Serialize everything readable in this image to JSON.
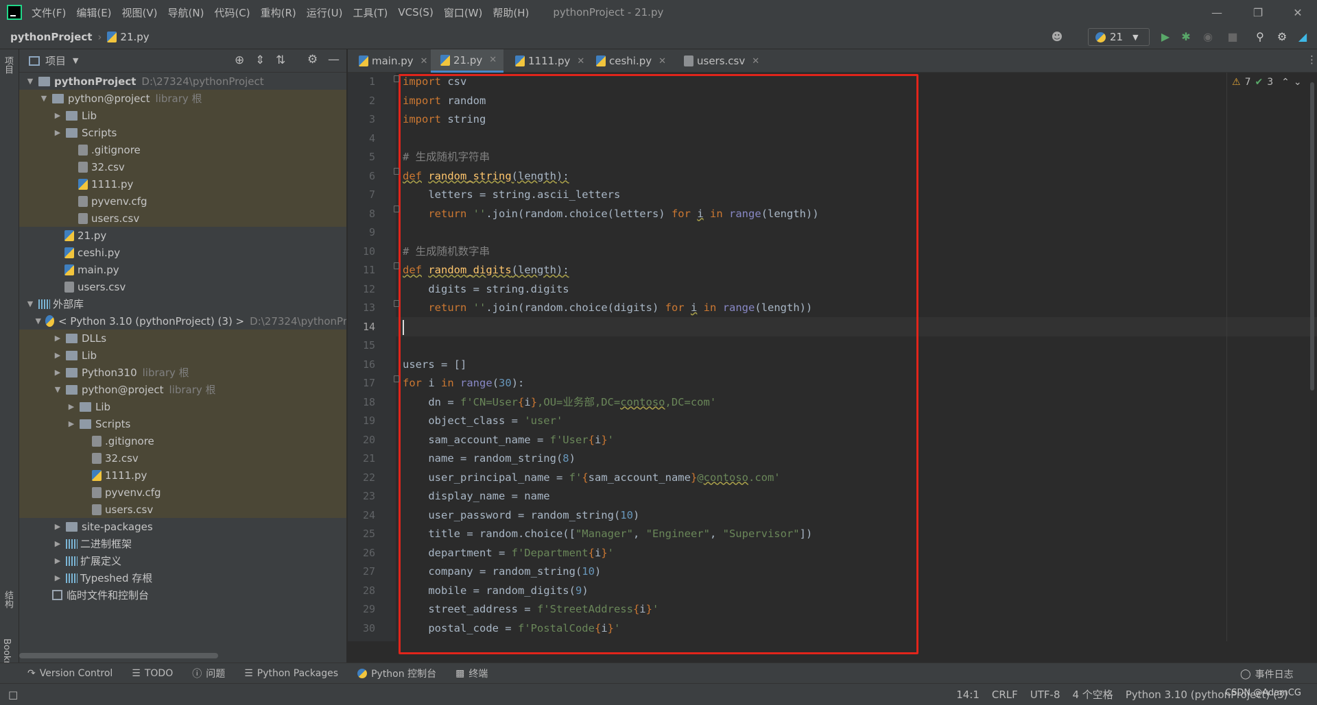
{
  "menubar": {
    "items": [
      "文件(F)",
      "编辑(E)",
      "视图(V)",
      "导航(N)",
      "代码(C)",
      "重构(R)",
      "运行(U)",
      "工具(T)",
      "VCS(S)",
      "窗口(W)",
      "帮助(H)"
    ],
    "window_title": "pythonProject - 21.py"
  },
  "navbar": {
    "project": "pythonProject",
    "file": "21.py",
    "run_config": "21"
  },
  "project_panel": {
    "title": "项目",
    "root": "pythonProject",
    "root_path": "D:\\27324\\pythonProject",
    "lib_hint": "library 根",
    "rows": [
      {
        "label": "python@project",
        "hint": "library 根"
      },
      {
        "label": "Lib"
      },
      {
        "label": "Scripts"
      },
      {
        "label": ".gitignore"
      },
      {
        "label": "32.csv"
      },
      {
        "label": "1111.py"
      },
      {
        "label": "pyvenv.cfg"
      },
      {
        "label": "users.csv"
      },
      {
        "label": "21.py"
      },
      {
        "label": "ceshi.py"
      },
      {
        "label": "main.py"
      },
      {
        "label": "users.csv"
      },
      {
        "label": "外部库"
      },
      {
        "label": "< Python 3.10 (pythonProject) (3) >",
        "hint": "D:\\27324\\pythonPr"
      },
      {
        "label": "DLLs"
      },
      {
        "label": "Lib"
      },
      {
        "label": "Python310",
        "hint": "library 根"
      },
      {
        "label": "python@project",
        "hint": "library 根"
      },
      {
        "label": "Lib"
      },
      {
        "label": "Scripts"
      },
      {
        "label": ".gitignore"
      },
      {
        "label": "32.csv"
      },
      {
        "label": "1111.py"
      },
      {
        "label": "pyvenv.cfg"
      },
      {
        "label": "users.csv"
      },
      {
        "label": "site-packages"
      },
      {
        "label": "二进制框架"
      },
      {
        "label": "扩展定义"
      },
      {
        "label": "Typeshed 存根"
      },
      {
        "label": "临时文件和控制台"
      }
    ]
  },
  "left_strip": {
    "project_tab": "项目",
    "structure_tab": "结构",
    "bookmarks_tab": "Bookmarks"
  },
  "tabs": [
    "main.py",
    "21.py",
    "1111.py",
    "ceshi.py",
    "users.csv"
  ],
  "inspections": {
    "warnings": "7",
    "ok": "3"
  },
  "editor": {
    "line_numbers": [
      "1",
      "2",
      "3",
      "4",
      "5",
      "6",
      "7",
      "8",
      "9",
      "10",
      "11",
      "12",
      "13",
      "14",
      "15",
      "16",
      "17",
      "18",
      "19",
      "20",
      "21",
      "22",
      "23",
      "24",
      "25",
      "26",
      "27",
      "28",
      "29",
      "30"
    ],
    "comment1": "# 生成随机字符串",
    "comment2": "# 生成随机数字串",
    "dn_str": "f'CN=User{i},OU=业务部,DC=contoso,DC=com'"
  },
  "bottom_tools": [
    "Version Control",
    "TODO",
    "问题",
    "Python Packages",
    "Python 控制台",
    "终端",
    "事件日志"
  ],
  "statusbar": {
    "position": "14:1",
    "line_sep": "CRLF",
    "encoding": "UTF-8",
    "indent": "4 个空格",
    "interpreter": "Python 3.10 (pythonProject) (3)",
    "watermark": "CSDN @AdamCG"
  }
}
